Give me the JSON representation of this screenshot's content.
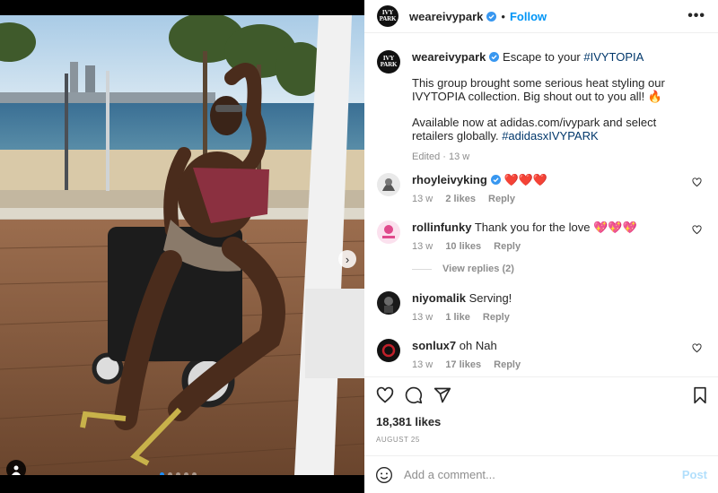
{
  "post": {
    "account": {
      "username": "weareivypark",
      "avatar_text": [
        "IVY",
        "PARK"
      ],
      "follow_label": "Follow",
      "more_label": "•••"
    },
    "caption": {
      "username": "weareivypark",
      "text1": "Escape to your ",
      "hashtag1": "#IVYTOPIA",
      "text2": "This group brought some serious heat styling our IVYTOPIA collection. Big shout out to you all! 🔥",
      "text3": "Available now at adidas.com/ivypark and select retailers globally. ",
      "hashtag2": "#adidasxIVYPARK",
      "edited": "Edited",
      "time": "13 w"
    },
    "comments": [
      {
        "username": "rhoyleivyking",
        "text": "❤️❤️❤️",
        "time": "13 w",
        "likes": "2 likes",
        "reply": "Reply"
      },
      {
        "username": "rollinfunky",
        "text": "Thank you for the love 💖💖💖",
        "time": "13 w",
        "likes": "10 likes",
        "reply": "Reply"
      },
      {
        "username": "niyomalik",
        "text": "Serving!",
        "time": "13 w",
        "likes": "1 like",
        "reply": "Reply"
      },
      {
        "username": "sonlux7",
        "text": "oh Nah",
        "time": "13 w",
        "likes": "17 likes",
        "reply": "Reply"
      }
    ],
    "view_replies": "View replies (2)",
    "likes_count": "18,381 likes",
    "date": "AUGUST 25",
    "add_comment": {
      "placeholder": "Add a comment...",
      "post_label": "Post"
    },
    "media": {
      "slide_count": 5,
      "active_slide": 1
    }
  },
  "colors": {
    "accent": "#0095f6",
    "verified": "#3897f0",
    "post_disabled": "#b2dffc",
    "muted": "#8e8e8e"
  },
  "icons": [
    "verified-badge-icon",
    "more-icon",
    "chevron-right-icon",
    "tag-user-icon",
    "heart-icon",
    "comment-icon",
    "share-icon",
    "bookmark-icon",
    "emoji-icon"
  ]
}
